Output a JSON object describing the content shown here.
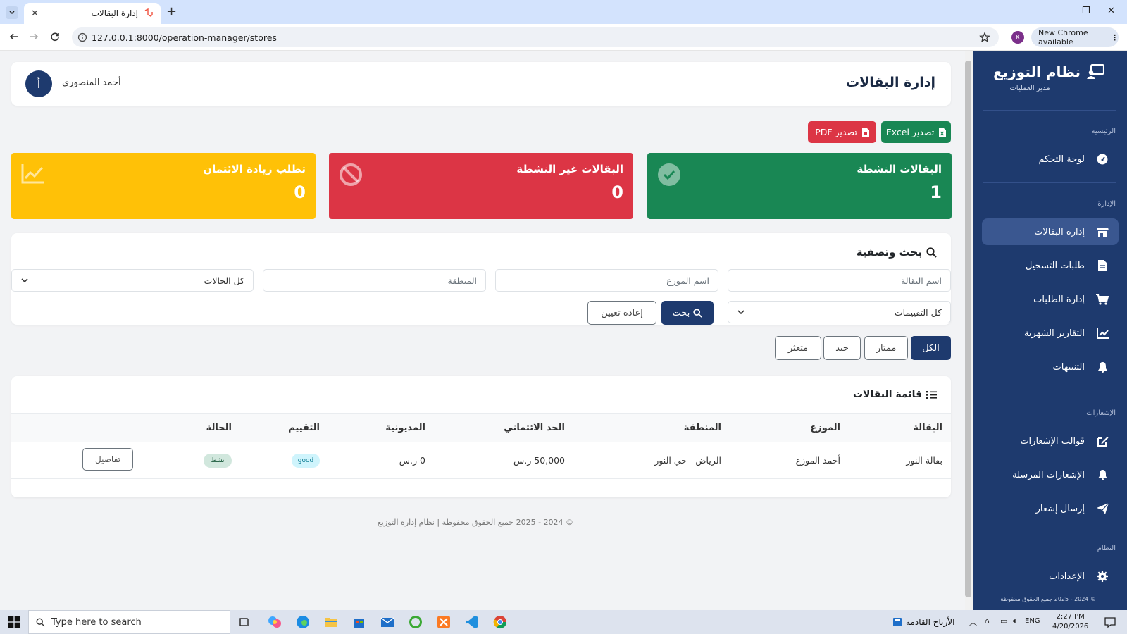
{
  "browser": {
    "tab_title": "إدارة البقالات",
    "url": "127.0.0.1:8000/operation-manager/stores",
    "new_chrome": "New Chrome available",
    "profile_initial": "K"
  },
  "sidebar": {
    "brand": "نظام التوزيع",
    "role": "مدير العمليات",
    "sections": {
      "main": "الرئيسية",
      "admin": "الإدارة",
      "notifications": "الإشعارات",
      "system": "النظام"
    },
    "items": [
      {
        "label": "لوحة التحكم",
        "icon": "dashboard-icon"
      },
      {
        "label": "إدارة البقالات",
        "icon": "store-icon"
      },
      {
        "label": "طلبات التسجيل",
        "icon": "document-icon"
      },
      {
        "label": "إدارة الطلبات",
        "icon": "cart-icon"
      },
      {
        "label": "التقارير الشهرية",
        "icon": "chart-icon"
      },
      {
        "label": "التنبيهات",
        "icon": "bell-icon"
      },
      {
        "label": "قوالب الإشعارات",
        "icon": "edit-icon"
      },
      {
        "label": "الإشعارات المرسلة",
        "icon": "bell-icon"
      },
      {
        "label": "إرسال إشعار",
        "icon": "send-icon"
      },
      {
        "label": "الإعدادات",
        "icon": "gear-icon"
      }
    ],
    "footer": "© 2024 - 2025 جميع الحقوق محفوظة"
  },
  "header": {
    "title": "إدارة البقالات",
    "user_name": "أحمد المنصوري",
    "avatar_letter": "أ"
  },
  "export": {
    "excel": "تصدير Excel",
    "pdf": "تصدير PDF"
  },
  "stats": {
    "active": {
      "label": "البقالات النشطة",
      "value": "1"
    },
    "inactive": {
      "label": "البقالات غير النشطة",
      "value": "0"
    },
    "credit": {
      "label": "تطلب زيادة الائتمان",
      "value": "0"
    }
  },
  "search": {
    "title": "بحث وتصفية",
    "store_name_placeholder": "اسم البقالة",
    "distributor_placeholder": "اسم الموزع",
    "region_placeholder": "المنطقة",
    "status_select": "كل الحالات",
    "rating_select": "كل التقييمات",
    "search_button": "بحث",
    "reset_button": "إعادة تعيين"
  },
  "filters": [
    "الكل",
    "ممتاز",
    "جيد",
    "متعثر"
  ],
  "list": {
    "title": "قائمة البقالات",
    "columns": [
      "البقالة",
      "الموزع",
      "المنطقة",
      "الحد الائتماني",
      "المديونية",
      "التقييم",
      "الحالة"
    ],
    "rows": [
      {
        "store": "بقالة النور",
        "distributor": "أحمد الموزع",
        "region": "الرياض - حي النور",
        "credit_limit": "50,000 ر.س",
        "debt": "0 ر.س",
        "rating": "good",
        "status": "نشط",
        "action": "تفاصيل"
      }
    ]
  },
  "footer": "© 2024 - 2025 جميع الحقوق محفوظة | نظام إدارة التوزيع",
  "taskbar": {
    "search_placeholder": "Type here to search",
    "weather": "الأرباح القادمة",
    "lang": "ENG",
    "time": "2:27 PM",
    "date": "4/20/2026"
  },
  "colors": {
    "primary": "#1e3a6e",
    "success": "#198754",
    "danger": "#dc3545",
    "warning": "#ffc107"
  }
}
